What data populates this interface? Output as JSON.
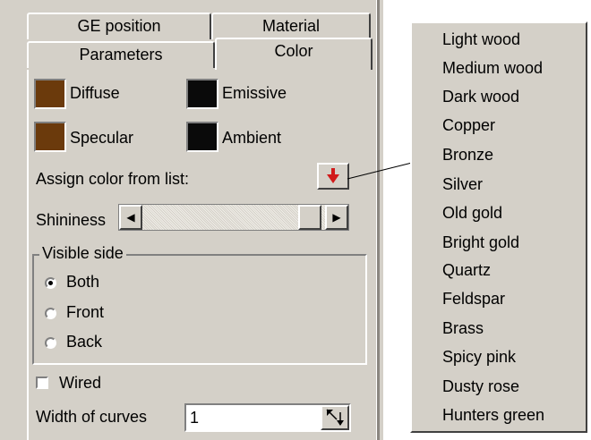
{
  "tabs": {
    "row_back": [
      "GE position",
      "Material"
    ],
    "row_front": [
      "Parameters",
      "Color"
    ],
    "active": "Color"
  },
  "colors": {
    "panel_bg": "#d4d0c8",
    "diffuse": "#6b3a0c",
    "specular": "#6b3a0c",
    "emissive": "#0a0a0a",
    "ambient": "#0a0a0a",
    "arrow": "#d11a1a"
  },
  "swatches": {
    "diffuse_label": "Diffuse",
    "emissive_label": "Emissive",
    "specular_label": "Specular",
    "ambient_label": "Ambient"
  },
  "assign": {
    "label": "Assign color from list:",
    "button_icon": "red-down-arrow-icon"
  },
  "shininess": {
    "label": "Shininess",
    "value_fraction": 0.88,
    "left_icon": "arrow-left-icon",
    "right_icon": "arrow-right-icon"
  },
  "visible_side": {
    "title": "Visible side",
    "options": [
      "Both",
      "Front",
      "Back"
    ],
    "selected": "Both"
  },
  "wired": {
    "label": "Wired",
    "checked": false
  },
  "width_of_curves": {
    "label": "Width of curves",
    "value": "1",
    "spin_icon": "spin-up-down-icon"
  },
  "color_list": [
    "Light wood",
    "Medium wood",
    "Dark wood",
    "Copper",
    "Bronze",
    "Silver",
    "Old gold",
    "Bright gold",
    "Quartz",
    "Feldspar",
    "Brass",
    "Spicy pink",
    "Dusty rose",
    "Hunters green"
  ]
}
